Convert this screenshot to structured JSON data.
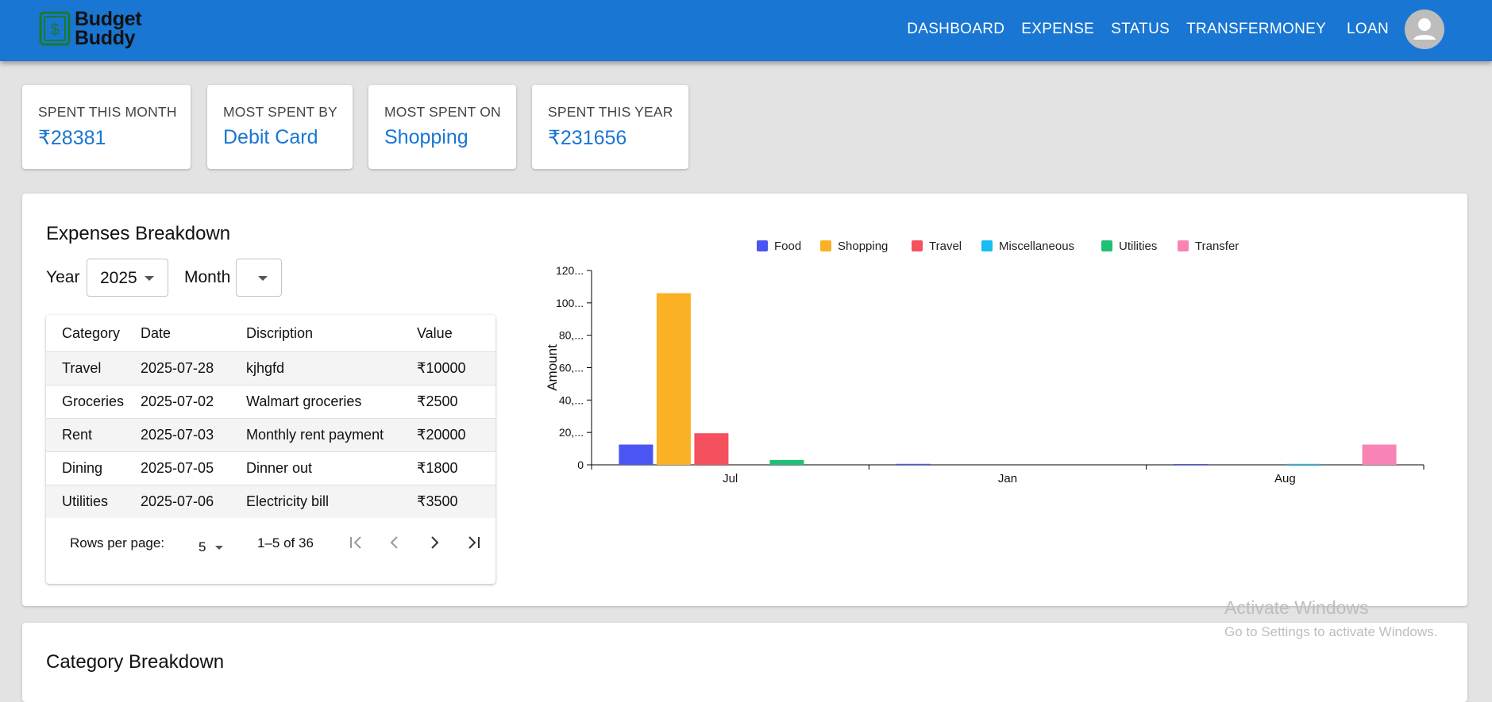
{
  "app": {
    "logo_line1": "Budget",
    "logo_line2": "Buddy",
    "nav": [
      "DASHBOARD",
      "EXPENSE",
      "STATUS",
      "TRANSFERMONEY",
      "LOAN"
    ]
  },
  "colors": {
    "appbar": "#1976d2",
    "accent": "#1976d2"
  },
  "stats": [
    {
      "label": "SPENT THIS MONTH",
      "value": "₹28381"
    },
    {
      "label": "MOST SPENT BY",
      "value": "Debit Card"
    },
    {
      "label": "MOST SPENT ON",
      "value": "Shopping"
    },
    {
      "label": "SPENT THIS YEAR",
      "value": "₹231656"
    }
  ],
  "breakdown": {
    "title": "Expenses Breakdown",
    "year_label": "Year",
    "year_value": "2025",
    "month_label": "Month",
    "month_value": "",
    "table": {
      "headers": [
        "Category",
        "Date",
        "Discription",
        "Value"
      ],
      "rows": [
        [
          "Travel",
          "2025-07-28",
          "kjhgfd",
          "₹10000"
        ],
        [
          "Groceries",
          "2025-07-02",
          "Walmart groceries",
          "₹2500"
        ],
        [
          "Rent",
          "2025-07-03",
          "Monthly rent payment",
          "₹20000"
        ],
        [
          "Dining",
          "2025-07-05",
          "Dinner out",
          "₹1800"
        ],
        [
          "Utilities",
          "2025-07-06",
          "Electricity bill",
          "₹3500"
        ]
      ]
    },
    "pagination": {
      "rows_per_page_label": "Rows per page:",
      "rows_per_page": "5",
      "range": "1–5 of 36"
    }
  },
  "chart_data": {
    "type": "bar",
    "categories": [
      "Jul",
      "Jan",
      "Aug"
    ],
    "series": [
      {
        "name": "Food",
        "color": "#4a55f3",
        "values": [
          12500,
          600,
          500
        ]
      },
      {
        "name": "Shopping",
        "color": "#fbb124",
        "values": [
          106000,
          0,
          0
        ]
      },
      {
        "name": "Travel",
        "color": "#f5505e",
        "values": [
          19500,
          0,
          0
        ]
      },
      {
        "name": "Miscellaneous",
        "color": "#16bdee",
        "values": [
          0,
          0,
          600
        ]
      },
      {
        "name": "Utilities",
        "color": "#1fbf74",
        "values": [
          3000,
          0,
          0
        ]
      },
      {
        "name": "Transfer",
        "color": "#f884b5",
        "values": [
          0,
          0,
          12500
        ]
      }
    ],
    "yticks": [
      "0",
      "20,...",
      "40,...",
      "60,...",
      "80,...",
      "100...",
      "120..."
    ],
    "ylabel": "Amount",
    "ylim": [
      0,
      120000
    ],
    "legend": "top-center"
  },
  "category_breakdown": {
    "title": "Category Breakdown"
  },
  "watermark": {
    "line1": "Activate Windows",
    "line2": "Go to Settings to activate Windows."
  }
}
